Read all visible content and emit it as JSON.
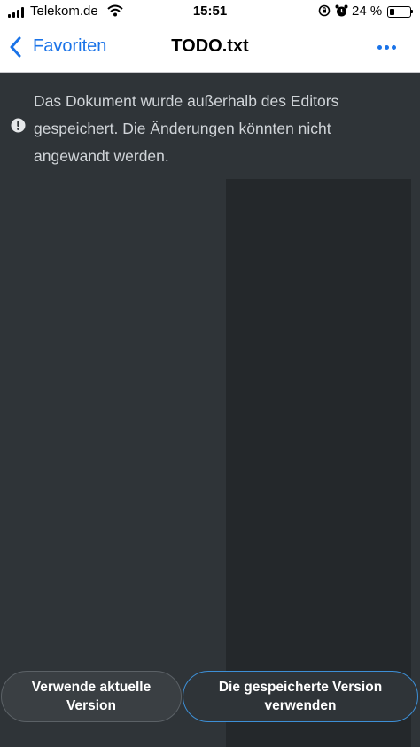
{
  "status_bar": {
    "carrier": "Telekom.de",
    "time": "15:51",
    "battery_percent": "24 %",
    "battery_level": 0.24,
    "icons": [
      "signal-icon",
      "wifi-icon",
      "orientation-lock-icon",
      "alarm-icon",
      "battery-icon"
    ]
  },
  "nav": {
    "back_label": "Favoriten",
    "title": "TODO.txt",
    "more_icon": "ellipsis-icon"
  },
  "warning": {
    "icon": "exclamation-circle-icon",
    "message": "Das Dokument wurde außerhalb des Editors gespeichert. Die Änderungen könnten nicht angewandt werden."
  },
  "actions": {
    "use_current_label": "Verwende aktuelle Version",
    "use_saved_label": "Die gespeicherte Version verwenden"
  },
  "colors": {
    "accent": "#1a73e8",
    "background": "#2f3438",
    "panel": "#24282b",
    "saved_button_border": "#3d8fd6"
  }
}
